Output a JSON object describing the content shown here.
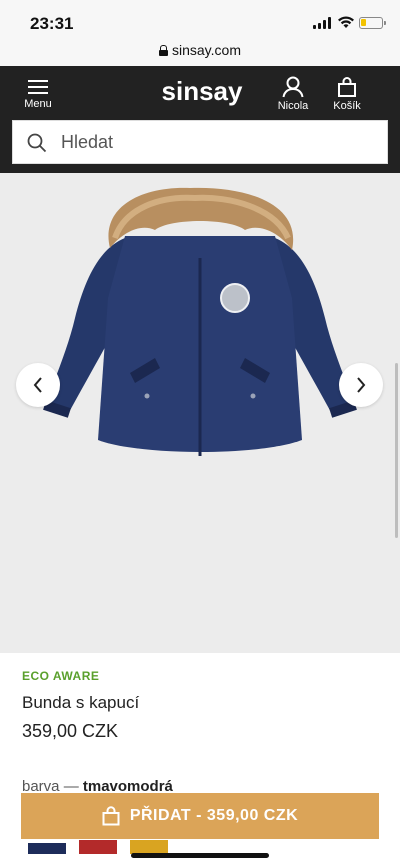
{
  "status_bar": {
    "time": "23:31"
  },
  "browser": {
    "url": "sinsay.com"
  },
  "header": {
    "menu_label": "Menu",
    "logo_text": "sinsay",
    "account_label": "Nicola",
    "cart_label": "Košík"
  },
  "search": {
    "placeholder": "Hledat"
  },
  "product": {
    "badge": "ECO AWARE",
    "name": "Bunda s kapucí",
    "price": "359,00 CZK",
    "color_label": "barva —",
    "color_value": "tmavomodrá"
  },
  "swatches": [
    {
      "name": "tmavomodrá",
      "color": "#1d2c5a"
    },
    {
      "name": "červená",
      "color": "#b32a2a"
    },
    {
      "name": "hořčicová",
      "color": "#d9a421"
    }
  ],
  "cta": {
    "add_label": "PŘIDAT - 359,00 CZK"
  },
  "colors": {
    "header_bg": "#222222",
    "cta_bg": "#dba458",
    "eco_green": "#5aa02c",
    "gallery_bg": "#ececec"
  },
  "icons": {
    "menu": "hamburger-icon",
    "account": "user-icon",
    "cart": "bag-icon",
    "search": "search-icon",
    "prev": "chevron-left-icon",
    "next": "chevron-right-icon",
    "lock": "lock-icon"
  }
}
